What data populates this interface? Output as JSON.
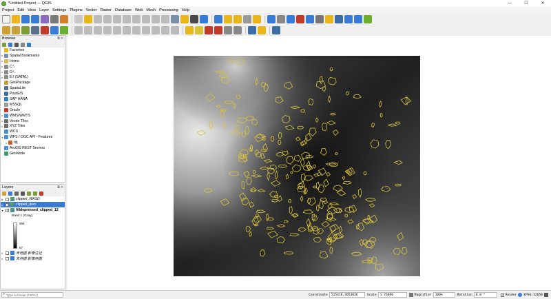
{
  "window": {
    "title": "*Untitled Project — QGIS",
    "controls": [
      "—",
      "☐",
      "✕"
    ]
  },
  "menu": [
    {
      "label": "Project"
    },
    {
      "label": "Edit"
    },
    {
      "label": "View"
    },
    {
      "label": "Layer"
    },
    {
      "label": "Settings"
    },
    {
      "label": "Plugins"
    },
    {
      "label": "Vector"
    },
    {
      "label": "Raster"
    },
    {
      "label": "Database"
    },
    {
      "label": "Web"
    },
    {
      "label": "Mesh"
    },
    {
      "label": "Processing"
    },
    {
      "label": "Help"
    }
  ],
  "browser": {
    "title": "Browser",
    "items": [
      {
        "label": "Favorites",
        "icon": "star-icon",
        "color": "#e8b51a",
        "expand": ""
      },
      {
        "label": "Spatial Bookmarks",
        "icon": "bookmark-icon",
        "color": "#7a8fa8",
        "expand": "▸"
      },
      {
        "label": "Home",
        "icon": "folder-icon",
        "color": "#d9b75a",
        "expand": "▸"
      },
      {
        "label": "C:\\",
        "icon": "drive-icon",
        "color": "#8a8a8a",
        "expand": "▸"
      },
      {
        "label": "D:\\",
        "icon": "drive-icon",
        "color": "#8a8a8a",
        "expand": "▸"
      },
      {
        "label": "E:\\ (SATA1)",
        "icon": "drive-icon",
        "color": "#8a8a8a",
        "expand": "▸"
      },
      {
        "label": "GeoPackage",
        "icon": "geopackage-icon",
        "color": "#c7a23b",
        "expand": ""
      },
      {
        "label": "SpatiaLite",
        "icon": "feather-icon",
        "color": "#5e6f8e",
        "expand": ""
      },
      {
        "label": "PostGIS",
        "icon": "elephant-icon",
        "color": "#3a6ea5",
        "expand": ""
      },
      {
        "label": "SAP HANA",
        "icon": "database-icon",
        "color": "#2e7dc1",
        "expand": ""
      },
      {
        "label": "MSSQL",
        "icon": "database-icon",
        "color": "#9a9a9a",
        "expand": ""
      },
      {
        "label": "Oracle",
        "icon": "database-icon",
        "color": "#c03b2b",
        "expand": ""
      },
      {
        "label": "WMS/WMTS",
        "icon": "globe-icon",
        "color": "#4a8fd0",
        "expand": "▸"
      },
      {
        "label": "Vector Tiles",
        "icon": "grid-icon",
        "color": "#6c6c6c",
        "expand": "▸"
      },
      {
        "label": "XYZ Tiles",
        "icon": "grid-icon",
        "color": "#6c6c6c",
        "expand": "▸"
      },
      {
        "label": "WCS",
        "icon": "globe-icon",
        "color": "#4a8fd0",
        "expand": ""
      },
      {
        "label": "WFS / OGC API - Features",
        "icon": "globe-icon",
        "color": "#4a8fd0",
        "expand": "▾"
      },
      {
        "label": "tdj",
        "icon": "link-icon",
        "color": "#d06030",
        "expand": "▸",
        "indent": true
      },
      {
        "label": "ArcGIS REST Servers",
        "icon": "globe-icon",
        "color": "#4a8fd0",
        "expand": ""
      },
      {
        "label": "GeoNode",
        "icon": "geonode-icon",
        "color": "#3c9a6a",
        "expand": ""
      }
    ]
  },
  "layers": {
    "title": "Layers",
    "items": [
      {
        "label": "clipped_WASD",
        "icon": "raster-icon",
        "checked": false,
        "selected": false,
        "italic": true
      },
      {
        "label": "clipped_dem",
        "icon": "raster-icon",
        "checked": true,
        "selected": true,
        "italic": false
      },
      {
        "label": "filldepressed_clipped_12_",
        "icon": "raster-icon",
        "checked": true,
        "selected": false,
        "italic": false,
        "bold": true
      }
    ],
    "band_label": "Band 1 (Gray)",
    "ramp_max": "559",
    "ramp_min": "67",
    "extra": [
      {
        "label": "天地图 影像注记",
        "checked": false
      },
      {
        "label": "天地图 影像地图",
        "checked": false
      }
    ]
  },
  "status": {
    "locate_placeholder": "Type to locate (Ctrl+K)",
    "coordinate_label": "Coordinate",
    "coordinate_value": "515418,4053036",
    "scale_label": "Scale",
    "scale_value": "1:76096",
    "magnifier_label": "Magnifier",
    "magnifier_value": "100%",
    "rotation_label": "Rotation",
    "rotation_value": "0.0 °",
    "render_label": "Render",
    "crs_label": "EPSG:32650"
  }
}
